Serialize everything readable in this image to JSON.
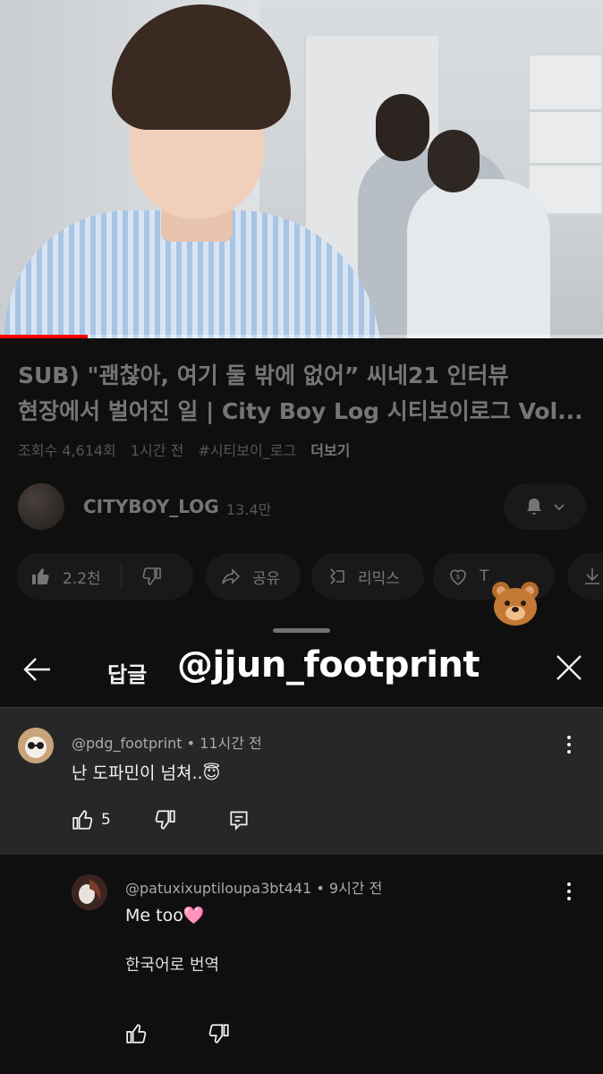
{
  "video": {
    "progress_fraction": 0.145
  },
  "info": {
    "title_line1": "SUB) \"괜찮아, 여기 둘 밖에 없어” 씨네21 인터뷰",
    "title_line2": "현장에서 벌어진 일 | City Boy Log 시티보이로그 Vol...",
    "views": "조회수 4,614회",
    "age": "1시간 전",
    "hashtag": "#시티보이_로그",
    "more": "더보기",
    "channel_name": "CITYBOY_LOG",
    "subscribers": "13.4만",
    "likes": "2.2천",
    "share_label": "공유",
    "remix_label": "리믹스",
    "thanks_label": "T"
  },
  "panel": {
    "title": "답글",
    "watermark": "@jjun_footprint"
  },
  "comments": [
    {
      "author": "@pdg_footprint",
      "time": "11시간 전",
      "text": "난 도파민이 넘쳐..😇",
      "likes": "5"
    },
    {
      "author": "@patuxixuptiloupa3bt441",
      "time": "9시간 전",
      "text": "Me too🩷",
      "translate": "한국어로 번역"
    }
  ],
  "icons": {
    "back": "arrow-left-icon",
    "close": "close-icon",
    "like": "thumbs-up-icon",
    "dislike": "thumbs-down-icon",
    "reply": "reply-icon",
    "more": "more-vertical-icon",
    "bell": "bell-icon",
    "share": "share-icon",
    "remix": "remix-icon",
    "thanks": "thanks-icon",
    "download": "download-icon",
    "sticker": "bear-emoji"
  }
}
